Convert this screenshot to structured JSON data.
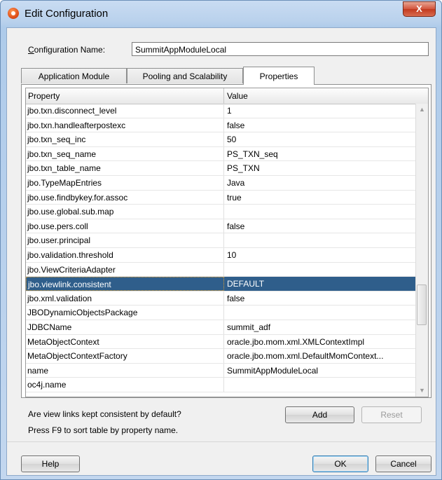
{
  "window": {
    "title": "Edit Configuration",
    "close_label": "X"
  },
  "config": {
    "label_prefix": "C",
    "label_rest": "onfiguration Name:",
    "value": "SummitAppModuleLocal"
  },
  "tabs": [
    {
      "label": "Application Module"
    },
    {
      "label": "Pooling and Scalability"
    },
    {
      "label": "Properties"
    }
  ],
  "table": {
    "headers": {
      "property": "Property",
      "value": "Value"
    },
    "rows": [
      {
        "property": "jbo.txn.disconnect_level",
        "value": "1"
      },
      {
        "property": "jbo.txn.handleafterpostexc",
        "value": "false"
      },
      {
        "property": "jbo.txn_seq_inc",
        "value": "50"
      },
      {
        "property": "jbo.txn_seq_name",
        "value": "PS_TXN_seq"
      },
      {
        "property": "jbo.txn_table_name",
        "value": "PS_TXN"
      },
      {
        "property": "jbo.TypeMapEntries",
        "value": "Java"
      },
      {
        "property": "jbo.use.findbykey.for.assoc",
        "value": "true"
      },
      {
        "property": "jbo.use.global.sub.map",
        "value": ""
      },
      {
        "property": "jbo.use.pers.coll",
        "value": "false"
      },
      {
        "property": "jbo.user.principal",
        "value": ""
      },
      {
        "property": "jbo.validation.threshold",
        "value": "10"
      },
      {
        "property": "jbo.ViewCriteriaAdapter",
        "value": ""
      },
      {
        "property": "jbo.viewlink.consistent",
        "value": "DEFAULT"
      },
      {
        "property": "jbo.xml.validation",
        "value": "false"
      },
      {
        "property": "JBODynamicObjectsPackage",
        "value": ""
      },
      {
        "property": "JDBCName",
        "value": "summit_adf"
      },
      {
        "property": "MetaObjectContext",
        "value": "oracle.jbo.mom.xml.XMLContextImpl"
      },
      {
        "property": "MetaObjectContextFactory",
        "value": "oracle.jbo.mom.xml.DefaultMomContext..."
      },
      {
        "property": "name",
        "value": "SummitAppModuleLocal"
      },
      {
        "property": "oc4j.name",
        "value": ""
      }
    ]
  },
  "description": {
    "line1": "Are view links kept consistent by default?",
    "line2": "Press F9 to sort table by property name."
  },
  "buttons": {
    "add": "Add",
    "reset": "Reset",
    "help": "Help",
    "ok": "OK",
    "cancel": "Cancel"
  }
}
